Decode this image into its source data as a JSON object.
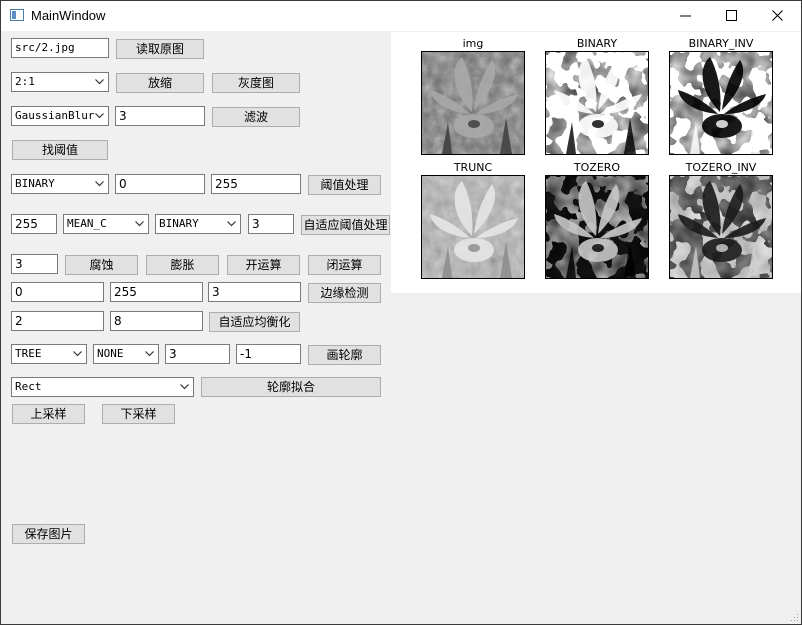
{
  "window": {
    "title": "MainWindow"
  },
  "row_read": {
    "path_value": "src/2.jpg",
    "read_label": "读取原图"
  },
  "row_scale": {
    "ratio_value": "2:1",
    "scale_label": "放缩",
    "gray_label": "灰度图"
  },
  "row_filter": {
    "filter_value": "GaussianBlur",
    "ksize_value": "3",
    "filter_label": "滤波"
  },
  "row_find": {
    "find_label": "找阈值"
  },
  "row_thresh": {
    "type_value": "BINARY",
    "thresh_value": "0",
    "maxval_value": "255",
    "thresh_label": "阈值处理"
  },
  "row_adaptive": {
    "maxval_value": "255",
    "method_value": "MEAN_C",
    "type_value": "BINARY",
    "block_value": "3",
    "adaptive_label": "自适应阈值处理"
  },
  "row_morph": {
    "ksize_value": "3",
    "erode_label": "腐蚀",
    "dilate_label": "膨胀",
    "open_label": "开运算",
    "close_label": "闭运算"
  },
  "row_edge": {
    "low_value": "0",
    "high_value": "255",
    "aperture_value": "3",
    "edge_label": "边缘检测"
  },
  "row_clahe": {
    "clip_value": "2",
    "tile_value": "8",
    "clahe_label": "自适应均衡化"
  },
  "row_contour": {
    "mode_value": "TREE",
    "approx_value": "NONE",
    "thickness_value": "3",
    "index_value": "-1",
    "draw_label": "画轮廓"
  },
  "row_fit": {
    "shape_value": "Rect",
    "fit_label": "轮廓拟合"
  },
  "row_pyr": {
    "up_label": "上采样",
    "down_label": "下采样"
  },
  "row_save": {
    "save_label": "保存图片"
  },
  "plots": [
    {
      "title": "img",
      "variant": "gray"
    },
    {
      "title": "BINARY",
      "variant": "binary"
    },
    {
      "title": "BINARY_INV",
      "variant": "binary_inv"
    },
    {
      "title": "TRUNC",
      "variant": "trunc"
    },
    {
      "title": "TOZERO",
      "variant": "tozero"
    },
    {
      "title": "TOZERO_INV",
      "variant": "tozero_inv"
    }
  ],
  "icons": {
    "app": "app-window-icon",
    "min": "minimize-icon",
    "max": "maximize-icon",
    "close": "close-icon",
    "dropdown": "chevron-down-icon",
    "grip": "resize-grip-icon"
  }
}
